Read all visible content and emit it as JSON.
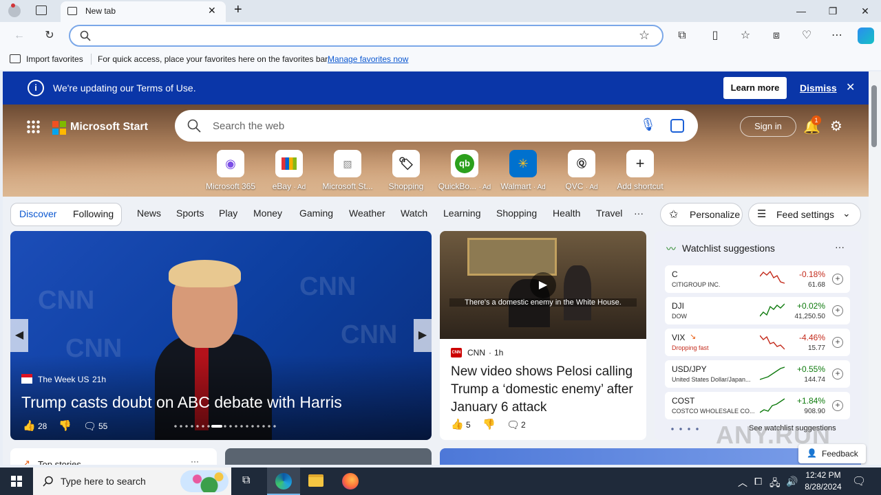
{
  "browser": {
    "tab_title": "New tab",
    "fav_import": "Import favorites",
    "fav_message": "For quick access, place your favorites here on the favorites bar.",
    "fav_manage": "Manage favorites now"
  },
  "banner": {
    "text": "We're updating our Terms of Use.",
    "learn_more": "Learn more",
    "dismiss": "Dismiss"
  },
  "header": {
    "brand": "Microsoft Start",
    "search_placeholder": "Search the web",
    "sign_in": "Sign in",
    "notif_count": "1"
  },
  "shortcuts": [
    {
      "label": "Microsoft 365",
      "ad": ""
    },
    {
      "label": "eBay",
      "ad": "· Ad"
    },
    {
      "label": "Microsoft St...",
      "ad": ""
    },
    {
      "label": "Shopping",
      "ad": ""
    },
    {
      "label": "QuickBo...",
      "ad": "· Ad"
    },
    {
      "label": "Walmart",
      "ad": "· Ad"
    },
    {
      "label": "QVC",
      "ad": "· Ad"
    },
    {
      "label": "Add shortcut",
      "ad": ""
    }
  ],
  "nav": {
    "discover": "Discover",
    "following": "Following",
    "items": [
      "News",
      "Sports",
      "Play",
      "Money",
      "Gaming",
      "Weather",
      "Watch",
      "Learning",
      "Shopping",
      "Health",
      "Travel"
    ],
    "more": "···",
    "personalize": "Personalize",
    "feed_settings": "Feed settings"
  },
  "hero": {
    "source": "The Week US",
    "age": "21h",
    "headline": "Trump casts doubt on ABC debate with Harris",
    "likes": "28",
    "comments": "55",
    "bg_text": "CNN"
  },
  "video": {
    "caption": "There's a domestic enemy in the White House.",
    "source": "CNN",
    "age": "1h",
    "headline": "New video shows Pelosi calling Trump a ‘domestic enemy’ after January 6 attack",
    "likes": "5",
    "comments": "2"
  },
  "watchlist": {
    "title": "Watchlist suggestions",
    "see_more": "See watchlist suggestions",
    "stocks": [
      {
        "sym": "C",
        "name": "CITIGROUP INC.",
        "pct": "-0.18%",
        "price": "61.68",
        "color": "#c42b1c"
      },
      {
        "sym": "DJI",
        "name": "DOW",
        "pct": "+0.02%",
        "price": "41,250.50",
        "color": "#0e7a0d"
      },
      {
        "sym": "VIX",
        "name": "Dropping fast",
        "pct": "-4.46%",
        "price": "15.77",
        "color": "#c42b1c"
      },
      {
        "sym": "USD/JPY",
        "name": "United States Dollar/Japan...",
        "pct": "+0.55%",
        "price": "144.74",
        "color": "#0e7a0d"
      },
      {
        "sym": "COST",
        "name": "COSTCO WHOLESALE CO...",
        "pct": "+1.84%",
        "price": "908.90",
        "color": "#0e7a0d"
      }
    ]
  },
  "lower": {
    "top_stories": "Top stories",
    "feedback": "Feedback"
  },
  "taskbar": {
    "search": "Type here to search",
    "time": "12:42 PM",
    "date": "8/28/2024"
  },
  "watermark": "ANY.RUN"
}
